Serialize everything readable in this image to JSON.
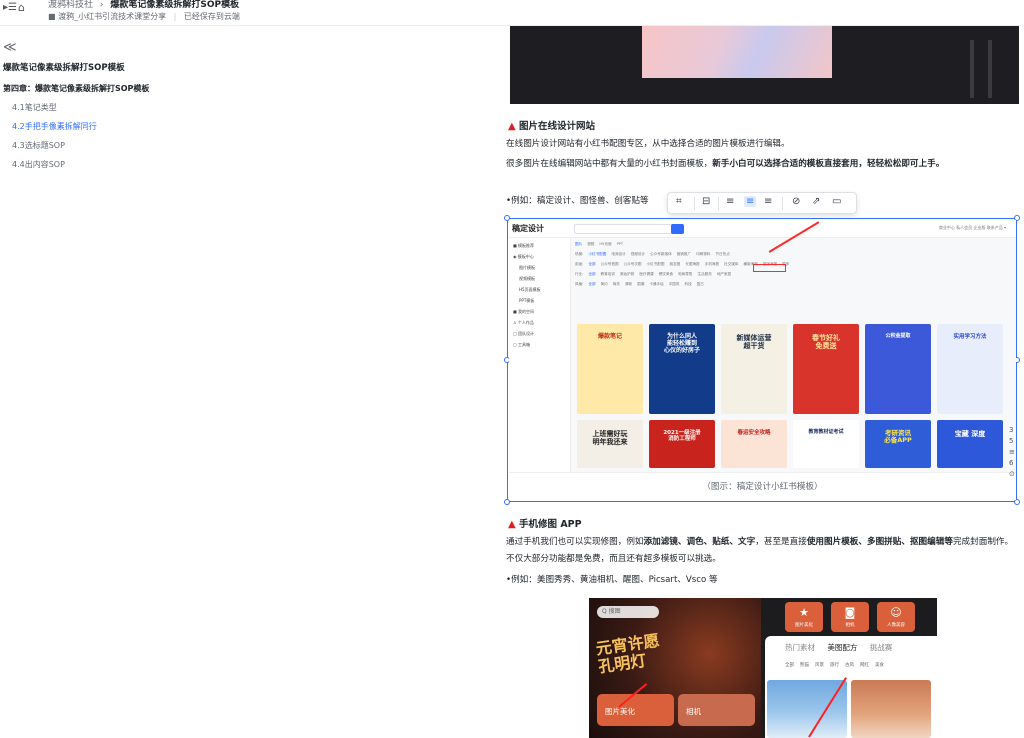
{
  "topbar": {
    "menu_glyph": "▸☰",
    "home_glyph": "⌂",
    "crumb_root": "渡鸦科技社",
    "crumb_sep": "›",
    "crumb_current": "爆款笔记像素级拆解打SOP模板",
    "sub_folder_glyph": "■",
    "sub_folder": "渡鸦_小红书引流技术课堂分享",
    "sub_status": "已经保存到云端"
  },
  "toc": {
    "collapse_glyph": "≪",
    "doc_title": "爆款笔记像素级拆解打SOP模板",
    "chapter": "第四章：爆款笔记像素级拆解打SOP模板",
    "items": [
      "4.1笔记类型",
      "4.2手把手像素拆解同行",
      "4.3选标题SOP",
      "4.4出内容SOP"
    ],
    "active_index": 1
  },
  "content": {
    "section1_title": "图片在线设计网站",
    "p1": "在线图片设计网站有小红书配图专区，从中选择合适的图片模板进行编辑。",
    "p2_a": "很多图片在线编辑网站中都有大量的小红书封面模板，",
    "p2_b": "新手小白可以选择合适的模板直接套用，轻轻松松即可上手。",
    "p3": "•例如：稿定设计、图怪兽、创客贴等",
    "caption": "（图示：稿定设计小红书模板）",
    "section2_title": "手机修图 APP",
    "p4_a": "通过手机我们也可以实现修图，例如",
    "p4_b": "添加滤镜、调色、贴纸、文字",
    "p4_c": "，甚至是直接",
    "p4_d": "使用图片模板、多图拼贴、抠图编辑等",
    "p4_e": "完成封面制作。不仅大部分功能都是免费，而且还有超多模板可以挑选。",
    "p5": "•例如：美图秀秀、黄油相机、醒图、Picsart、Vsco 等",
    "triangle": "▲"
  },
  "toolbar": {
    "icons": [
      "⌗",
      "⊟",
      "≡",
      "≡",
      "≡",
      "⊘",
      "⇗",
      "▭"
    ]
  },
  "screenshot": {
    "logo": "稿定设计",
    "side_items": [
      "■ 模板推荐",
      "◉ 模板中心",
      "图片模板",
      "视频模板",
      "H5页面模板",
      "PPT模板",
      "■ 我的空间",
      "♙ 个人作品",
      "□ 团队设计",
      "▢ 工具箱"
    ],
    "header_right": "商业中心   私人会员   企业版   联系产品 ▾",
    "filter_rows": [
      [
        "图片",
        "视频",
        "H5页面",
        "PPT"
      ],
      [
        "场景:",
        "小红书配图",
        "电商设计",
        "视频设计",
        "公众号新媒体",
        "营销推广",
        "印刷物料",
        "节日热点"
      ],
      [
        "用途:",
        "全部",
        "公众号首图",
        "公众号次图",
        "小红书配图",
        "朋友圈",
        "长图海报",
        "手机海报",
        "社交媒体",
        "横版海报",
        "竖版海报",
        "更多"
      ],
      [
        "行业:",
        "全部",
        "教育培训",
        "美妆护肤",
        "医疗健康",
        "餐饮美食",
        "电商零售",
        "生活服务",
        "地产家居"
      ],
      [
        "风格:",
        "全部",
        "简约",
        "商务",
        "清新",
        "国潮",
        "卡通手绘",
        "中国风",
        "科技",
        "复古"
      ]
    ],
    "cards_row1": [
      "爆款笔记",
      "为什么同人\n能轻松赚到\n心仪的好房子",
      "新媒体运营\n超干货",
      "春节好礼\n免费送",
      "公积金提取",
      "实用学习方法"
    ],
    "cards_row2": [
      "上班需好玩\n明年我还来",
      "2021一级注册\n消防工程师",
      "春运安全攻略",
      "教育教材证考试",
      "考研资讯\n必备APP",
      "宝藏 深度"
    ]
  },
  "phone": {
    "search": "Q 搜图",
    "calligraphy": "元宵许愿\n孔明灯",
    "btn_beautify": "图片美化",
    "btn_camera": "相机",
    "tiles": [
      "图片美化",
      "相机",
      "人像美容"
    ],
    "tabs": [
      "热门素材",
      "美图配方",
      "挑战赛"
    ],
    "subtabs": [
      "全部",
      "熊猫",
      "风景",
      "旅行",
      "古风",
      "网红",
      "美食"
    ]
  },
  "right_scroll": [
    "3",
    "5",
    "≡",
    "6",
    "⊙"
  ],
  "colors": {
    "accent": "#3370ff",
    "heading_triangle": "#e02020",
    "annotation_red": "#ff2a2a"
  }
}
